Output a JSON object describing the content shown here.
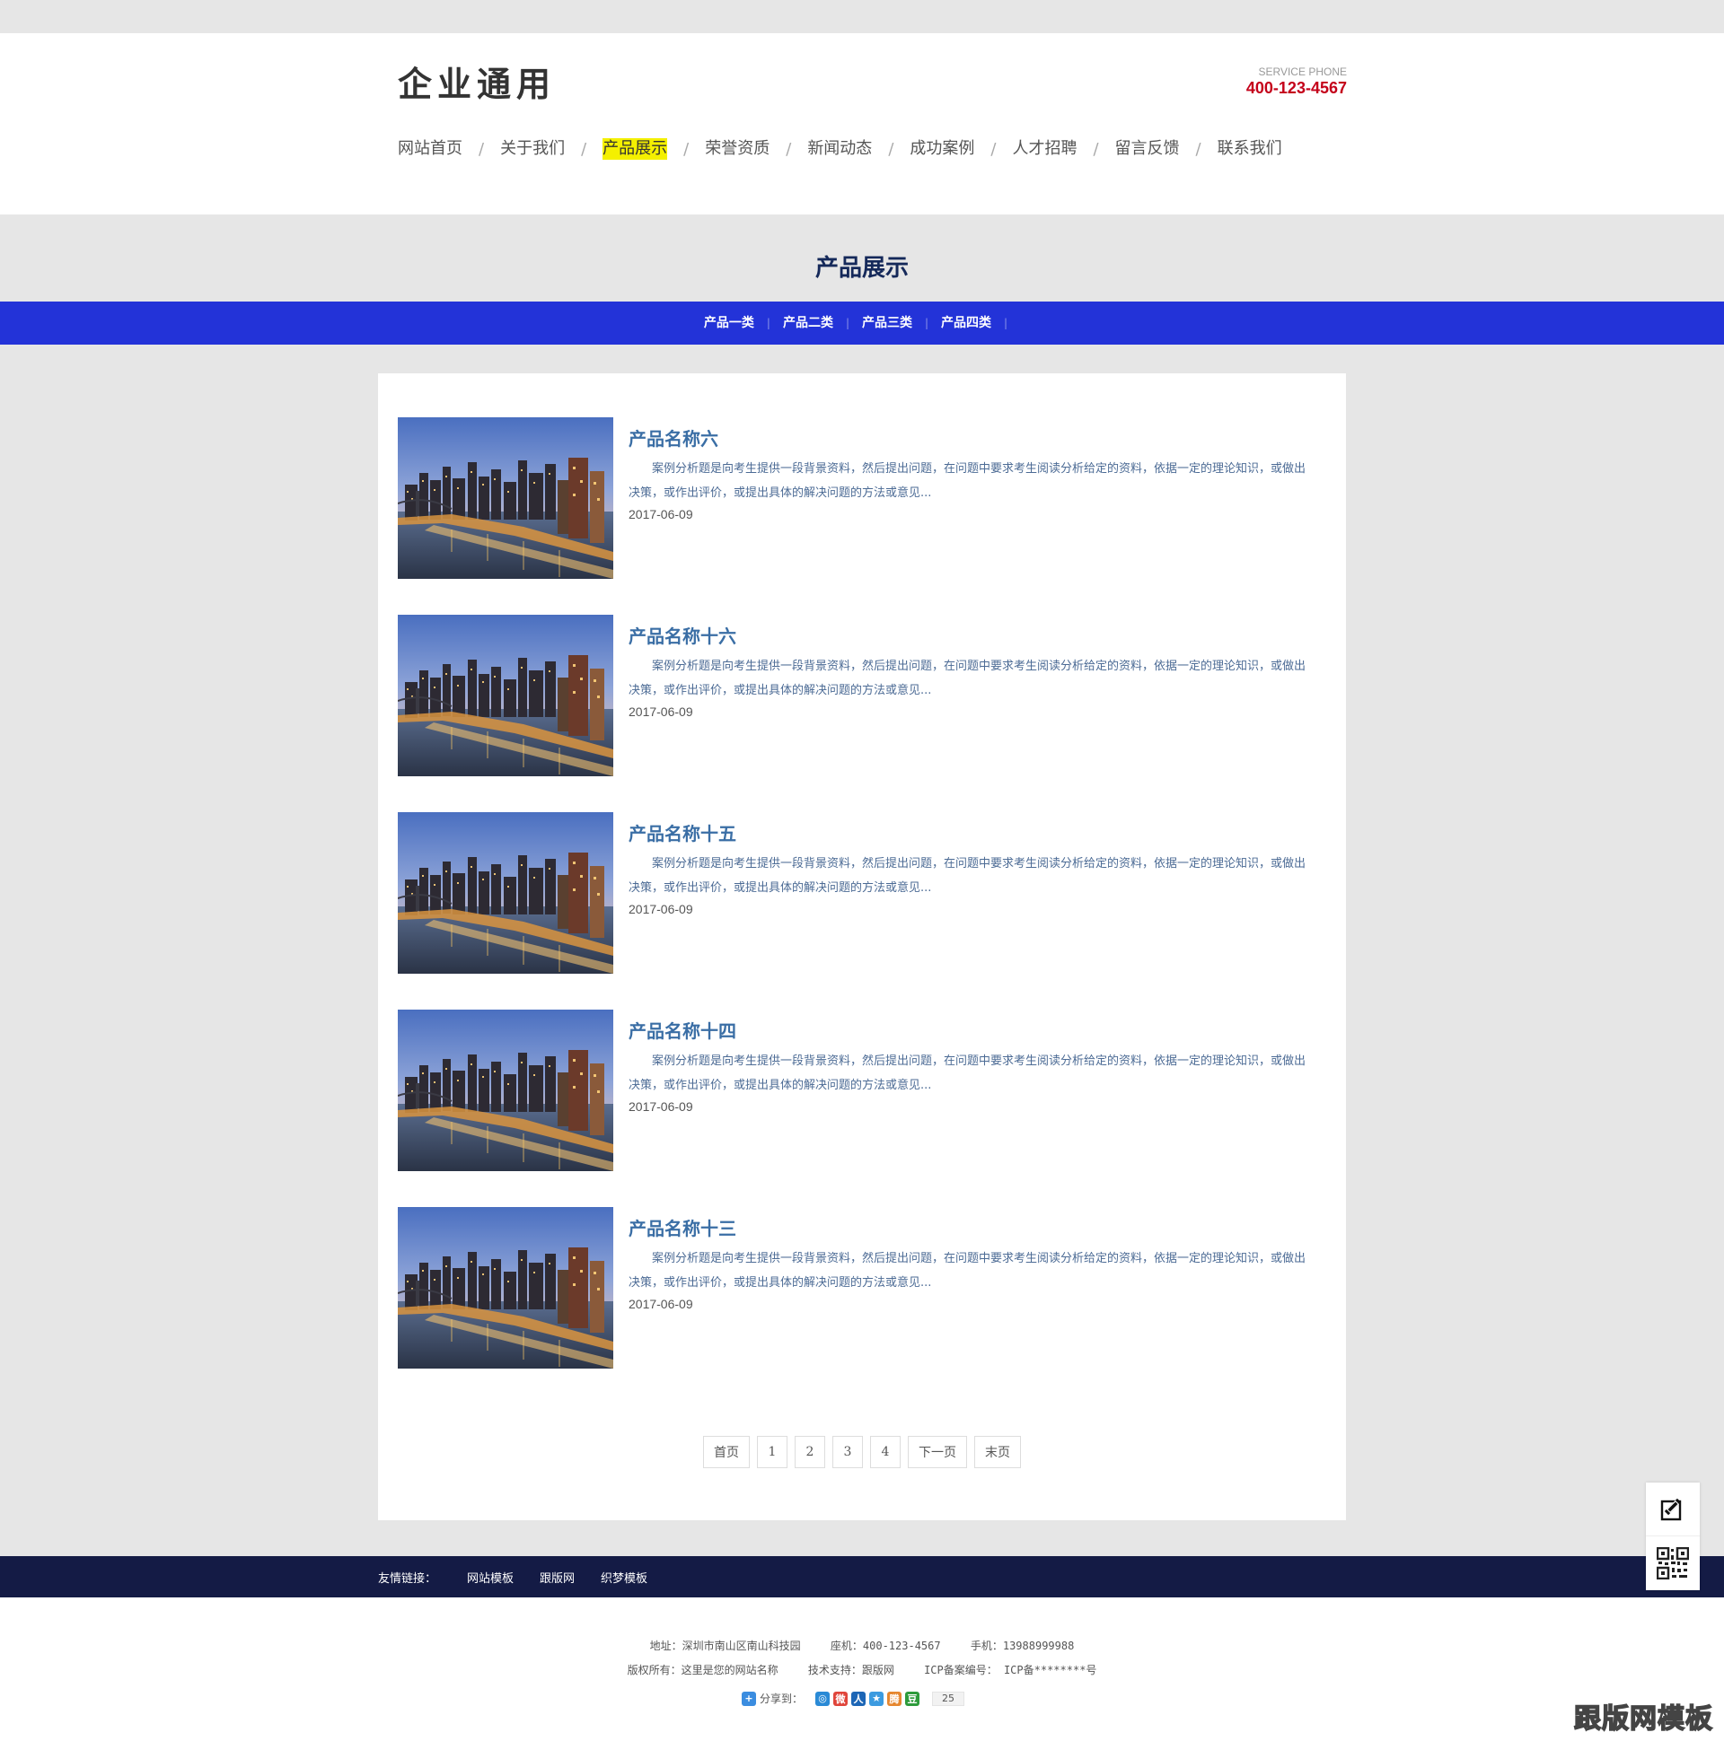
{
  "header": {
    "logo": "企业通用",
    "service_label": "SERVICE PHONE",
    "service_phone": "400-123-4567"
  },
  "nav": [
    {
      "label": "网站首页",
      "active": false
    },
    {
      "label": "关于我们",
      "active": false
    },
    {
      "label": "产品展示",
      "active": true
    },
    {
      "label": "荣誉资质",
      "active": false
    },
    {
      "label": "新闻动态",
      "active": false
    },
    {
      "label": "成功案例",
      "active": false
    },
    {
      "label": "人才招聘",
      "active": false
    },
    {
      "label": "留言反馈",
      "active": false
    },
    {
      "label": "联系我们",
      "active": false
    }
  ],
  "nav_separator": "/",
  "page_title": "产品展示",
  "categories": [
    "产品一类",
    "产品二类",
    "产品三类",
    "产品四类"
  ],
  "products": [
    {
      "title": "产品名称六",
      "desc": "案例分析题是向考生提供一段背景资料，然后提出问题，在问题中要求考生阅读分析给定的资料，依据一定的理论知识，或做出决策，或作出评价，或提出具体的解决问题的方法或意见...",
      "date": "2017-06-09"
    },
    {
      "title": "产品名称十六",
      "desc": "案例分析题是向考生提供一段背景资料，然后提出问题，在问题中要求考生阅读分析给定的资料，依据一定的理论知识，或做出决策，或作出评价，或提出具体的解决问题的方法或意见...",
      "date": "2017-06-09"
    },
    {
      "title": "产品名称十五",
      "desc": "案例分析题是向考生提供一段背景资料，然后提出问题，在问题中要求考生阅读分析给定的资料，依据一定的理论知识，或做出决策，或作出评价，或提出具体的解决问题的方法或意见...",
      "date": "2017-06-09"
    },
    {
      "title": "产品名称十四",
      "desc": "案例分析题是向考生提供一段背景资料，然后提出问题，在问题中要求考生阅读分析给定的资料，依据一定的理论知识，或做出决策，或作出评价，或提出具体的解决问题的方法或意见...",
      "date": "2017-06-09"
    },
    {
      "title": "产品名称十三",
      "desc": "案例分析题是向考生提供一段背景资料，然后提出问题，在问题中要求考生阅读分析给定的资料，依据一定的理论知识，或做出决策，或作出评价，或提出具体的解决问题的方法或意见...",
      "date": "2017-06-09"
    }
  ],
  "pager": [
    "首页",
    "1",
    "2",
    "3",
    "4",
    "下一页",
    "末页"
  ],
  "links": {
    "label": "友情链接：",
    "items": [
      "网站模板",
      "跟版网",
      "织梦模板"
    ]
  },
  "footer": {
    "address": "地址：深圳市南山区南山科技园",
    "landline": "座机：400-123-4567",
    "mobile": "手机：13988999988",
    "copyright": "版权所有：这里是您的网站名称",
    "support": "技术支持：跟版网",
    "icp": "ICP备案编号： ICP备********号",
    "share_label": "分享到：",
    "share_count": "25",
    "share_icons": [
      {
        "name": "qzone-icon",
        "glyph": "◎",
        "color": "#2a8ad6"
      },
      {
        "name": "weibo-icon",
        "glyph": "微",
        "color": "#e0453b"
      },
      {
        "name": "renren-icon",
        "glyph": "人",
        "color": "#1d66b6"
      },
      {
        "name": "kaixin-icon",
        "glyph": "★",
        "color": "#3c9be0"
      },
      {
        "name": "tqq-icon",
        "glyph": "腾",
        "color": "#e6872f"
      },
      {
        "name": "douban-icon",
        "glyph": "豆",
        "color": "#2d9b3b"
      }
    ]
  },
  "watermark": "跟版网模板",
  "colors": {
    "accent_nav_highlight": "#f4f000",
    "category_bar": "#2333d8",
    "footer_links_bar": "#141b45",
    "phone_red": "#c4001a",
    "product_title": "#3a6ea5"
  }
}
